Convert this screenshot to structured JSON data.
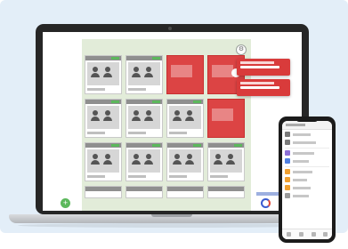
{
  "scene": {
    "background_color": "#e3eef8",
    "laptop_bezel_color": "#262626",
    "phone_bezel_color": "#1b1b1b"
  },
  "laptop_app": {
    "accent_colors": {
      "tile_alert": "#dc4444",
      "popup": "#d93b3b",
      "status_ok": "#5cb85c",
      "panel_background": "#e2ecd9"
    },
    "icons": {
      "settings": "gear-icon",
      "add": "plus-icon",
      "brand": "ring-logo-icon",
      "play": "play-icon",
      "avatar": "person-icon"
    },
    "tiles": [
      {
        "state": "normal"
      },
      {
        "state": "normal"
      },
      {
        "state": "alert"
      },
      {
        "state": "alert-play"
      },
      {
        "state": "normal"
      },
      {
        "state": "normal"
      },
      {
        "state": "normal"
      },
      {
        "state": "alert"
      },
      {
        "state": "normal"
      },
      {
        "state": "normal"
      },
      {
        "state": "normal"
      },
      {
        "state": "normal"
      },
      {
        "state": "partial"
      },
      {
        "state": "partial"
      },
      {
        "state": "partial"
      },
      {
        "state": "partial"
      }
    ],
    "popups": [
      {
        "type": "alert-notification"
      },
      {
        "type": "alert-notification"
      }
    ]
  },
  "phone_app": {
    "icons": [
      "menu-icon",
      "user-icon",
      "chat-icon",
      "calendar-icon",
      "file-icon",
      "settings-icon",
      "home-icon",
      "bell-icon"
    ],
    "nav_icons": [
      "home-icon",
      "list-icon",
      "person-icon",
      "more-icon"
    ]
  }
}
